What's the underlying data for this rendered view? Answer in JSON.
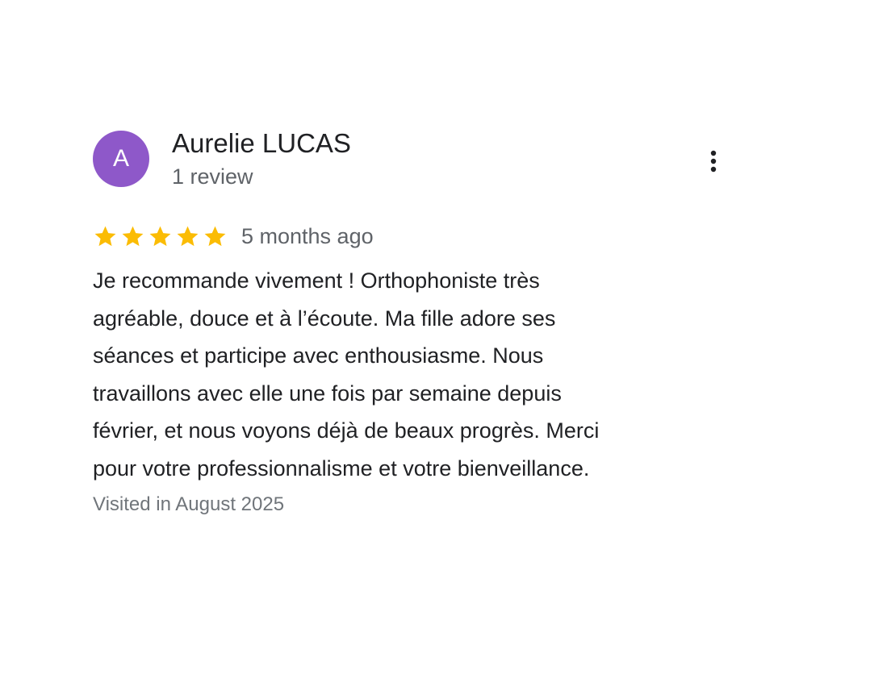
{
  "review": {
    "avatar": {
      "letter": "A",
      "color": "#8e58c9"
    },
    "reviewer_name": "Aurelie LUCAS",
    "review_count": "1 review",
    "more_options_icon": "more-vert-icon",
    "rating": {
      "stars": 5,
      "max": 5,
      "star_color": "#fbbc04"
    },
    "date": "5 months ago",
    "lines": [
      "Je recommande vivement ! Orthophoniste très",
      "agréable, douce et à l’écoute. Ma fille adore ses",
      "séances et participe avec enthousiasme. Nous",
      "travaillons avec elle une fois par semaine depuis",
      "février, et nous voyons déjà de beaux progrès. Merci",
      "pour votre professionnalisme et votre bienveillance."
    ],
    "visit_info": "Visited in August 2025"
  }
}
